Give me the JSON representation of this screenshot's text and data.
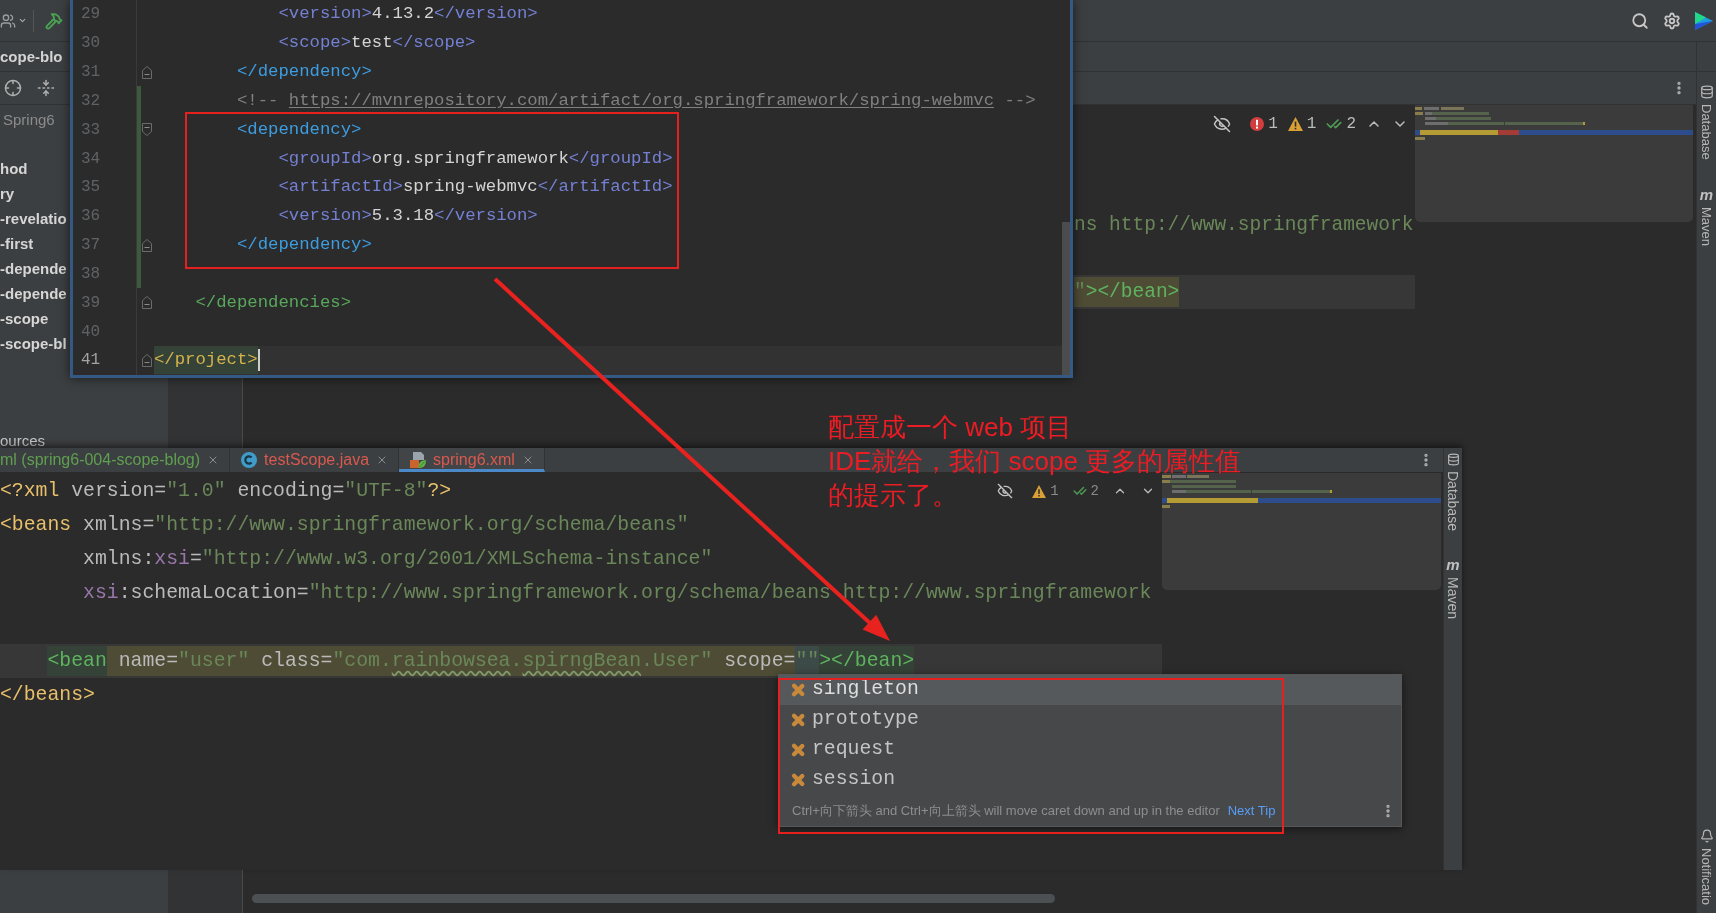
{
  "project_panel": {
    "header": "cope-blo",
    "items": [
      {
        "label": "Spring6",
        "kind": "path"
      },
      {
        "label": "hod",
        "kind": "module"
      },
      {
        "label": "ry",
        "kind": "module"
      },
      {
        "label": "-revelatio",
        "kind": "module"
      },
      {
        "label": "-first",
        "kind": "module"
      },
      {
        "label": "-depende",
        "kind": "module"
      },
      {
        "label": "-depende",
        "kind": "module"
      },
      {
        "label": "-scope",
        "kind": "module"
      },
      {
        "label": "-scope-bl",
        "kind": "module"
      }
    ],
    "footer_item": "ources"
  },
  "background_editor": {
    "inspection": {
      "errors": "1",
      "warnings": "1",
      "typos": "2"
    },
    "lines": [
      {
        "current": false
      },
      {
        "current": false
      },
      {
        "current": false
      },
      {
        "current": false,
        "tokens": [
          {
            "kind": "value",
            "text": "ns http://www.springframework"
          }
        ]
      },
      {
        "current": false
      },
      {
        "current": true,
        "tokens": [
          {
            "kind": "value",
            "text": "\"",
            "highlight": {
              "kind": "warning"
            }
          },
          {
            "kind": "tag",
            "text": "></bean>",
            "color": "#5fb35f",
            "highlight": {
              "kind": "warning"
            }
          }
        ]
      },
      {
        "current": false
      }
    ]
  },
  "tool_strip": [
    {
      "kind": "database",
      "label": "Database"
    },
    {
      "kind": "maven",
      "label": "Maven",
      "glyph": "m"
    }
  ],
  "notifications": "Notificatio",
  "pom_popup": {
    "lines": [
      {
        "number": "29",
        "current": false,
        "changed": false,
        "tokens": [
          {
            "kind": "tag",
            "text": "            <version>",
            "color": "#7480d4"
          },
          {
            "kind": "text",
            "text": "4.13.2"
          },
          {
            "kind": "tag",
            "text": "</version>",
            "color": "#7480d4"
          }
        ]
      },
      {
        "number": "30",
        "current": false,
        "changed": false,
        "tokens": [
          {
            "kind": "tag",
            "text": "            <scope>",
            "color": "#7480d4"
          },
          {
            "kind": "text",
            "text": "test"
          },
          {
            "kind": "tag",
            "text": "</scope>",
            "color": "#7480d4"
          }
        ]
      },
      {
        "number": "31",
        "current": false,
        "changed": false,
        "fold": {
          "kind": "end"
        },
        "tokens": [
          {
            "kind": "tag",
            "text": "        </dependency>",
            "color": "#3d9de0"
          }
        ]
      },
      {
        "number": "32",
        "current": false,
        "changed": true,
        "tokens": [
          {
            "kind": "comment",
            "text": "        <!-- "
          },
          {
            "kind": "link",
            "text": "https://mvnrepository.com/artifact/org.springframework/spring-webmvc"
          },
          {
            "kind": "comment",
            "text": " -->"
          }
        ]
      },
      {
        "number": "33",
        "current": false,
        "changed": true,
        "fold": {
          "kind": "start"
        },
        "tokens": [
          {
            "kind": "tag",
            "text": "        <dependency>",
            "color": "#3d9de0"
          }
        ]
      },
      {
        "number": "34",
        "current": false,
        "changed": true,
        "tokens": [
          {
            "kind": "tag",
            "text": "            <groupId>",
            "color": "#7480d4"
          },
          {
            "kind": "text",
            "text": "org.springframework"
          },
          {
            "kind": "tag",
            "text": "</groupId>",
            "color": "#7480d4"
          }
        ]
      },
      {
        "number": "35",
        "current": false,
        "changed": true,
        "tokens": [
          {
            "kind": "tag",
            "text": "            <artifactId>",
            "color": "#7480d4"
          },
          {
            "kind": "text",
            "text": "spring-webmvc"
          },
          {
            "kind": "tag",
            "text": "</artifactId>",
            "color": "#7480d4"
          }
        ]
      },
      {
        "number": "36",
        "current": false,
        "changed": true,
        "tokens": [
          {
            "kind": "tag",
            "text": "            <version>",
            "color": "#7480d4"
          },
          {
            "kind": "text",
            "text": "5.3.18"
          },
          {
            "kind": "tag",
            "text": "</version>",
            "color": "#7480d4"
          }
        ]
      },
      {
        "number": "37",
        "current": false,
        "changed": true,
        "fold": {
          "kind": "end"
        },
        "tokens": [
          {
            "kind": "tag",
            "text": "        </dependency>",
            "color": "#3d9de0"
          }
        ]
      },
      {
        "number": "38",
        "current": false,
        "changed": true
      },
      {
        "number": "39",
        "current": false,
        "changed": false,
        "fold": {
          "kind": "end"
        },
        "tokens": [
          {
            "kind": "tag",
            "text": "    </dependencies>",
            "color": "#58a85c"
          }
        ]
      },
      {
        "number": "40",
        "current": false,
        "changed": false
      },
      {
        "number": "41",
        "current": true,
        "changed": false,
        "fold": {
          "kind": "end"
        },
        "tokens": [
          {
            "kind": "tag",
            "text": "</project>",
            "color": "#d6b24c",
            "highlight": {
              "kind": "match"
            }
          }
        ]
      }
    ]
  },
  "xml_editor": {
    "tabs": [
      {
        "label": "ml (spring6-004-scope-blog)",
        "kind": "plain",
        "color": "#5f9f50",
        "selected": false
      },
      {
        "label": "testScope.java",
        "kind": "java",
        "color": "#d9594e",
        "selected": false
      },
      {
        "label": "spring6.xml",
        "kind": "xml",
        "color": "#d9594e",
        "selected": true
      }
    ],
    "inspection": {
      "warnings": "1",
      "typos": "2"
    },
    "lines": [
      {
        "current": false,
        "tokens": [
          {
            "kind": "tag",
            "text": "<?xml",
            "color": "#e8bf6a"
          },
          {
            "kind": "attr",
            "text": " version="
          },
          {
            "kind": "value",
            "text": "\"1.0\""
          },
          {
            "kind": "attr",
            "text": " encoding="
          },
          {
            "kind": "value",
            "text": "\"UTF-8\""
          },
          {
            "kind": "tag",
            "text": "?>",
            "color": "#e8bf6a"
          }
        ]
      },
      {
        "current": false,
        "tokens": [
          {
            "kind": "tag",
            "text": "<beans",
            "color": "#e8bf6a"
          },
          {
            "kind": "attr",
            "text": " xmlns="
          },
          {
            "kind": "value",
            "text": "\"http://www.springframework.org/schema/beans\""
          }
        ]
      },
      {
        "current": false,
        "tokens": [
          {
            "kind": "attr",
            "text": "       xmlns:"
          },
          {
            "kind": "ns",
            "text": "xsi"
          },
          {
            "kind": "attr",
            "text": "="
          },
          {
            "kind": "value",
            "text": "\"http://www.w3.org/2001/XMLSchema-instance\""
          }
        ]
      },
      {
        "current": false,
        "tokens": [
          {
            "kind": "ns",
            "text": "       xsi"
          },
          {
            "kind": "attr",
            "text": ":schemaLocation="
          },
          {
            "kind": "value",
            "text": "\"http://www.springframework.org/schema/beans http://www.springframework"
          }
        ]
      },
      {
        "current": false
      },
      {
        "current": true,
        "tokens": [
          {
            "kind": "tag",
            "text": "    <bean",
            "color": "#5fb35f",
            "highlight": {
              "kind": "match"
            }
          },
          {
            "kind": "attr",
            "text": " name=",
            "highlight": {
              "kind": "warning"
            }
          },
          {
            "kind": "value",
            "text": "\"user\"",
            "highlight": {
              "kind": "warning"
            }
          },
          {
            "kind": "attr",
            "text": " class=",
            "highlight": {
              "kind": "warning"
            }
          },
          {
            "kind": "value",
            "text": "\"com.",
            "highlight": {
              "kind": "warning"
            }
          },
          {
            "kind": "typo",
            "text": "rainbowsea",
            "highlight": {
              "kind": "warning"
            }
          },
          {
            "kind": "value",
            "text": ".",
            "highlight": {
              "kind": "warning"
            }
          },
          {
            "kind": "typo",
            "text": "spirngBean",
            "highlight": {
              "kind": "warning"
            }
          },
          {
            "kind": "value",
            "text": ".User\"",
            "highlight": {
              "kind": "warning"
            }
          },
          {
            "kind": "attr",
            "text": " scope=",
            "highlight": {
              "kind": "warning"
            }
          },
          {
            "kind": "value",
            "text": "\"\"",
            "highlight": {
              "kind": "caret"
            }
          },
          {
            "kind": "tag",
            "text": "></bean>",
            "color": "#5fb35f",
            "highlight": {
              "kind": "match"
            }
          }
        ]
      },
      {
        "current": false,
        "tokens": [
          {
            "kind": "tag",
            "text": "</beans>",
            "color": "#e8bf6a"
          }
        ]
      }
    ],
    "completion": {
      "items": [
        {
          "label": "singleton",
          "selected": true
        },
        {
          "label": "prototype",
          "selected": false
        },
        {
          "label": "request",
          "selected": false
        },
        {
          "label": "session",
          "selected": false
        }
      ],
      "tip": "Ctrl+向下箭头 and Ctrl+向上箭头 will move caret down and up in the editor",
      "tip_link": "Next Tip"
    },
    "tool_strip": [
      {
        "kind": "database",
        "label": "Database"
      },
      {
        "kind": "maven",
        "label": "Maven",
        "glyph": "m"
      }
    ]
  },
  "annotation": {
    "lines": [
      "配置成一个 web 项目",
      "IDE就给，我们 scope 更多的属性值",
      "的提示了。"
    ]
  }
}
